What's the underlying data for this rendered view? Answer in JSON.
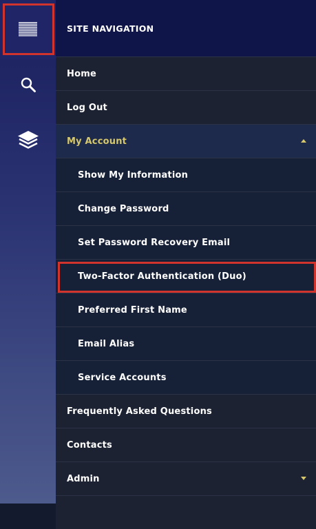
{
  "rail": {
    "icons": [
      "hamburger-menu-icon",
      "search-icon",
      "layers-icon"
    ]
  },
  "header": {
    "title": "SITE NAVIGATION"
  },
  "nav": {
    "home": "Home",
    "logout": "Log Out",
    "my_account": "My Account",
    "show_info": "Show My Information",
    "change_password": "Change Password",
    "recovery_email": "Set Password Recovery Email",
    "two_factor": "Two-Factor Authentication (Duo)",
    "preferred_name": "Preferred First Name",
    "email_alias": "Email Alias",
    "service_accounts": "Service Accounts",
    "faq": "Frequently Asked Questions",
    "contacts": "Contacts",
    "admin": "Admin"
  },
  "colors": {
    "accent": "#d6c86b",
    "highlight": "#d0342c",
    "header_bg": "#0f1548"
  }
}
